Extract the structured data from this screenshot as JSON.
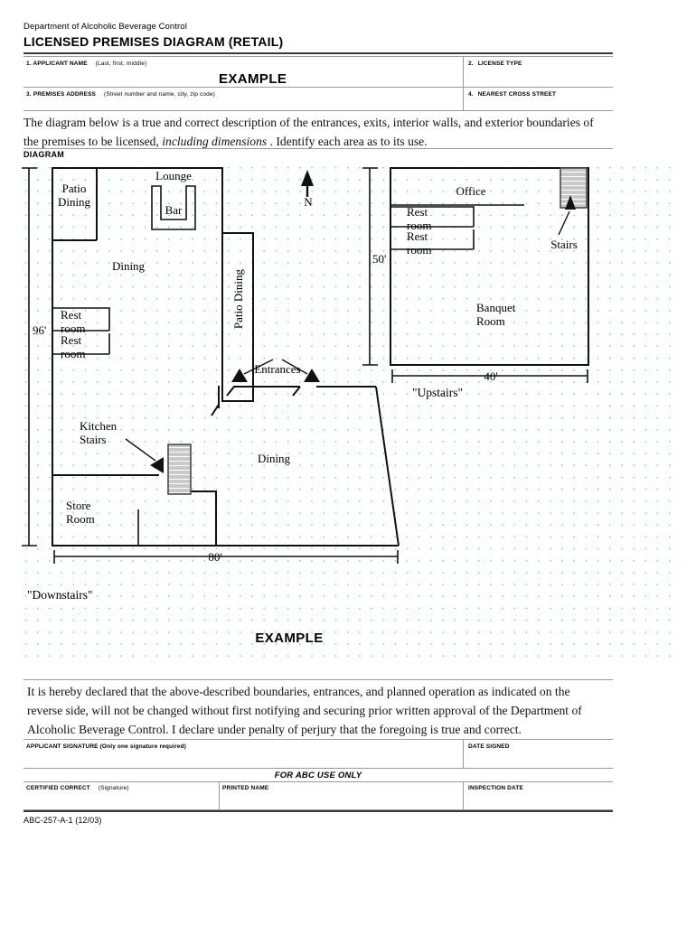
{
  "header": {
    "department": "Department of Alcoholic Beverage Control",
    "form_title": "LICENSED PREMISES DIAGRAM (RETAIL)"
  },
  "form_fields": {
    "applicant_name": {
      "number": "1.",
      "label": "APPLICANT NAME",
      "hint": "(Last, first, middle)",
      "value": "EXAMPLE"
    },
    "license_type": {
      "number": "2.",
      "label": "LICENSE TYPE",
      "value": ""
    },
    "premises_address": {
      "number": "3.",
      "label": "PREMISES ADDRESS",
      "hint": "(Street number and name, city, zip code)",
      "value": ""
    },
    "nearest_cross_street": {
      "number": "4.",
      "label": "NEAREST CROSS STREET",
      "value": ""
    }
  },
  "instructions": {
    "line1": "The diagram below is a true and correct description of the entrances, exits, interior walls, and exterior boundaries of",
    "line2_a": "the premises to be licensed, ",
    "line2_i": "including dimensions",
    "line2_b": " .  Identify each area as to its use.",
    "diagram_heading": "DIAGRAM"
  },
  "diagram": {
    "example_label": "EXAMPLE",
    "north_label": "N",
    "downstairs_caption": "\"Downstairs\"",
    "upstairs_caption": "\"Upstairs\"",
    "dimensions": {
      "left_height": "96'",
      "bottom_width": "80'",
      "upstairs_height": "50'",
      "upstairs_width": "40'"
    },
    "downstairs_rooms": [
      {
        "name": "patio-dining-left",
        "label_line1": "Patio",
        "label_line2": "Dining"
      },
      {
        "name": "lounge",
        "label": "Lounge"
      },
      {
        "name": "bar",
        "label": "Bar"
      },
      {
        "name": "dining-upper",
        "label": "Dining"
      },
      {
        "name": "restroom-1",
        "label_line1": "Rest",
        "label_line2": "room"
      },
      {
        "name": "restroom-2",
        "label_line1": "Rest",
        "label_line2": "room"
      },
      {
        "name": "patio-dining-right",
        "label": "Patio Dining"
      },
      {
        "name": "entrances",
        "label": "Entrances"
      },
      {
        "name": "kitchen-stairs",
        "label_line1": "Kitchen",
        "label_line2": "Stairs"
      },
      {
        "name": "dining-lower",
        "label": "Dining"
      },
      {
        "name": "store-room",
        "label_line1": "Store",
        "label_line2": "Room"
      }
    ],
    "upstairs_rooms": [
      {
        "name": "office",
        "label": "Office"
      },
      {
        "name": "restroom-1",
        "label_line1": "Rest",
        "label_line2": "room"
      },
      {
        "name": "restroom-2",
        "label_line1": "Rest",
        "label_line2": "room"
      },
      {
        "name": "stairs",
        "label": "Stairs"
      },
      {
        "name": "banquet-room",
        "label_line1": "Banquet",
        "label_line2": "Room"
      }
    ]
  },
  "declaration": {
    "line1": "It is hereby declared that the above-described boundaries, entrances, and planned operation as indicated on the",
    "line2": "reverse side, will not be changed without first notifying and securing prior written approval of the Department of",
    "line3": "Alcoholic Beverage Control.  I declare under penalty of perjury that the foregoing is true and correct."
  },
  "signature_block": {
    "applicant_signature": {
      "label": "APPLICANT SIGNATURE (Only one signature required)",
      "value": ""
    },
    "date_signed": {
      "label": "DATE SIGNED",
      "value": ""
    },
    "abc_use_only": "FOR ABC USE ONLY",
    "certified_correct": {
      "label": "CERTIFIED CORRECT",
      "hint": "(Signature)",
      "value": ""
    },
    "printed_name": {
      "label": "PRINTED NAME",
      "value": ""
    },
    "inspection_date": {
      "label": "INSPECTION DATE",
      "value": ""
    }
  },
  "footer": {
    "form_code": "ABC-257-A-1 (12/03)"
  },
  "colors": {
    "grid_dot": "#40e0f5",
    "wall": "#111111",
    "rule": "#9a9a9a",
    "rule_thick": "#3a3a3a",
    "stair_fill": "#c9c9c9"
  }
}
